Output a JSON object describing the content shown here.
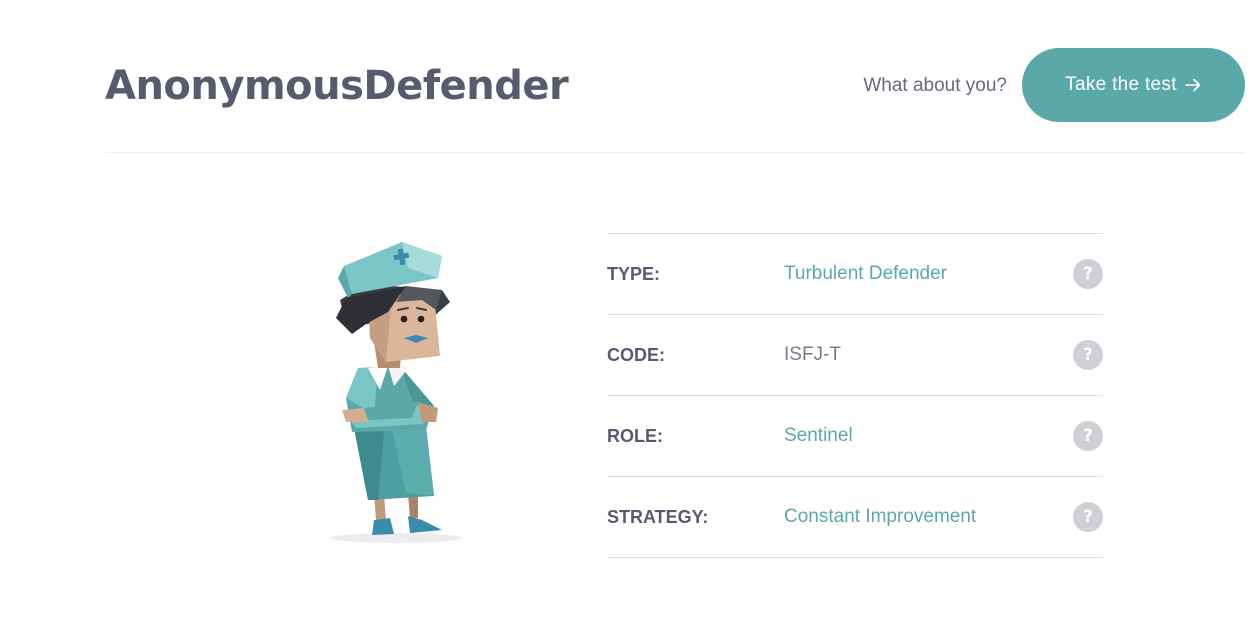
{
  "header": {
    "username": "AnonymousDefender",
    "prompt": "What about you?",
    "cta_label": "Take the test",
    "cta_icon": "arrow-right-icon"
  },
  "avatar": {
    "icon": "defender-character-illustration"
  },
  "facts": [
    {
      "label": "TYPE:",
      "value": "Turbulent Defender",
      "help_icon": "question-icon",
      "help_glyph": "?"
    },
    {
      "label": "CODE:",
      "value": "ISFJ-T",
      "help_icon": "question-icon",
      "help_glyph": "?"
    },
    {
      "label": "ROLE:",
      "value": "Sentinel",
      "help_icon": "question-icon",
      "help_glyph": "?"
    },
    {
      "label": "STRATEGY:",
      "value": "Constant Improvement",
      "help_icon": "question-icon",
      "help_glyph": "?"
    }
  ],
  "colors": {
    "accent": "#5ba8a9",
    "heading": "#575b6e",
    "muted": "#767a89",
    "help_icon_bg": "#cfd0d6",
    "divider": "#dcdee3"
  }
}
